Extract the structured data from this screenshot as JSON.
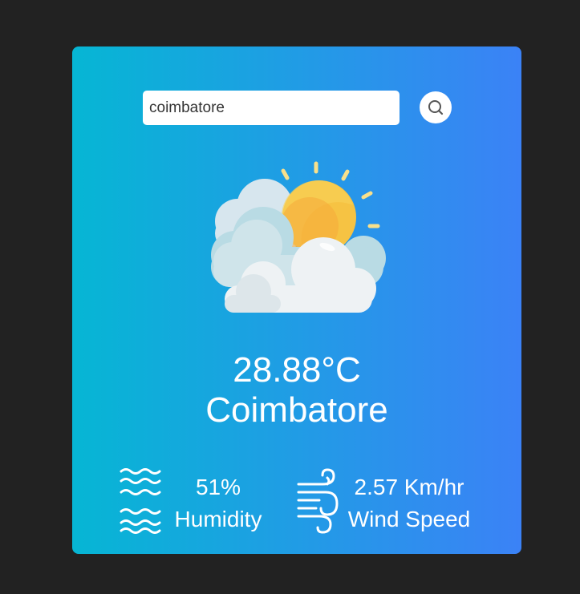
{
  "search": {
    "value": "coimbatore",
    "icon": "search-icon"
  },
  "weather": {
    "icon": "sun-behind-clouds-icon",
    "temperature": "28.88°C",
    "city": "Coimbatore"
  },
  "details": {
    "humidity": {
      "value": "51%",
      "label": "Humidity",
      "icon": "humidity-waves-icon"
    },
    "wind": {
      "value": "2.57 Km/hr",
      "label": "Wind Speed",
      "icon": "wind-icon"
    }
  },
  "colors": {
    "background": "#222222",
    "gradient_start": "#06b6d4",
    "gradient_end": "#3b82f6",
    "text": "#ffffff"
  }
}
